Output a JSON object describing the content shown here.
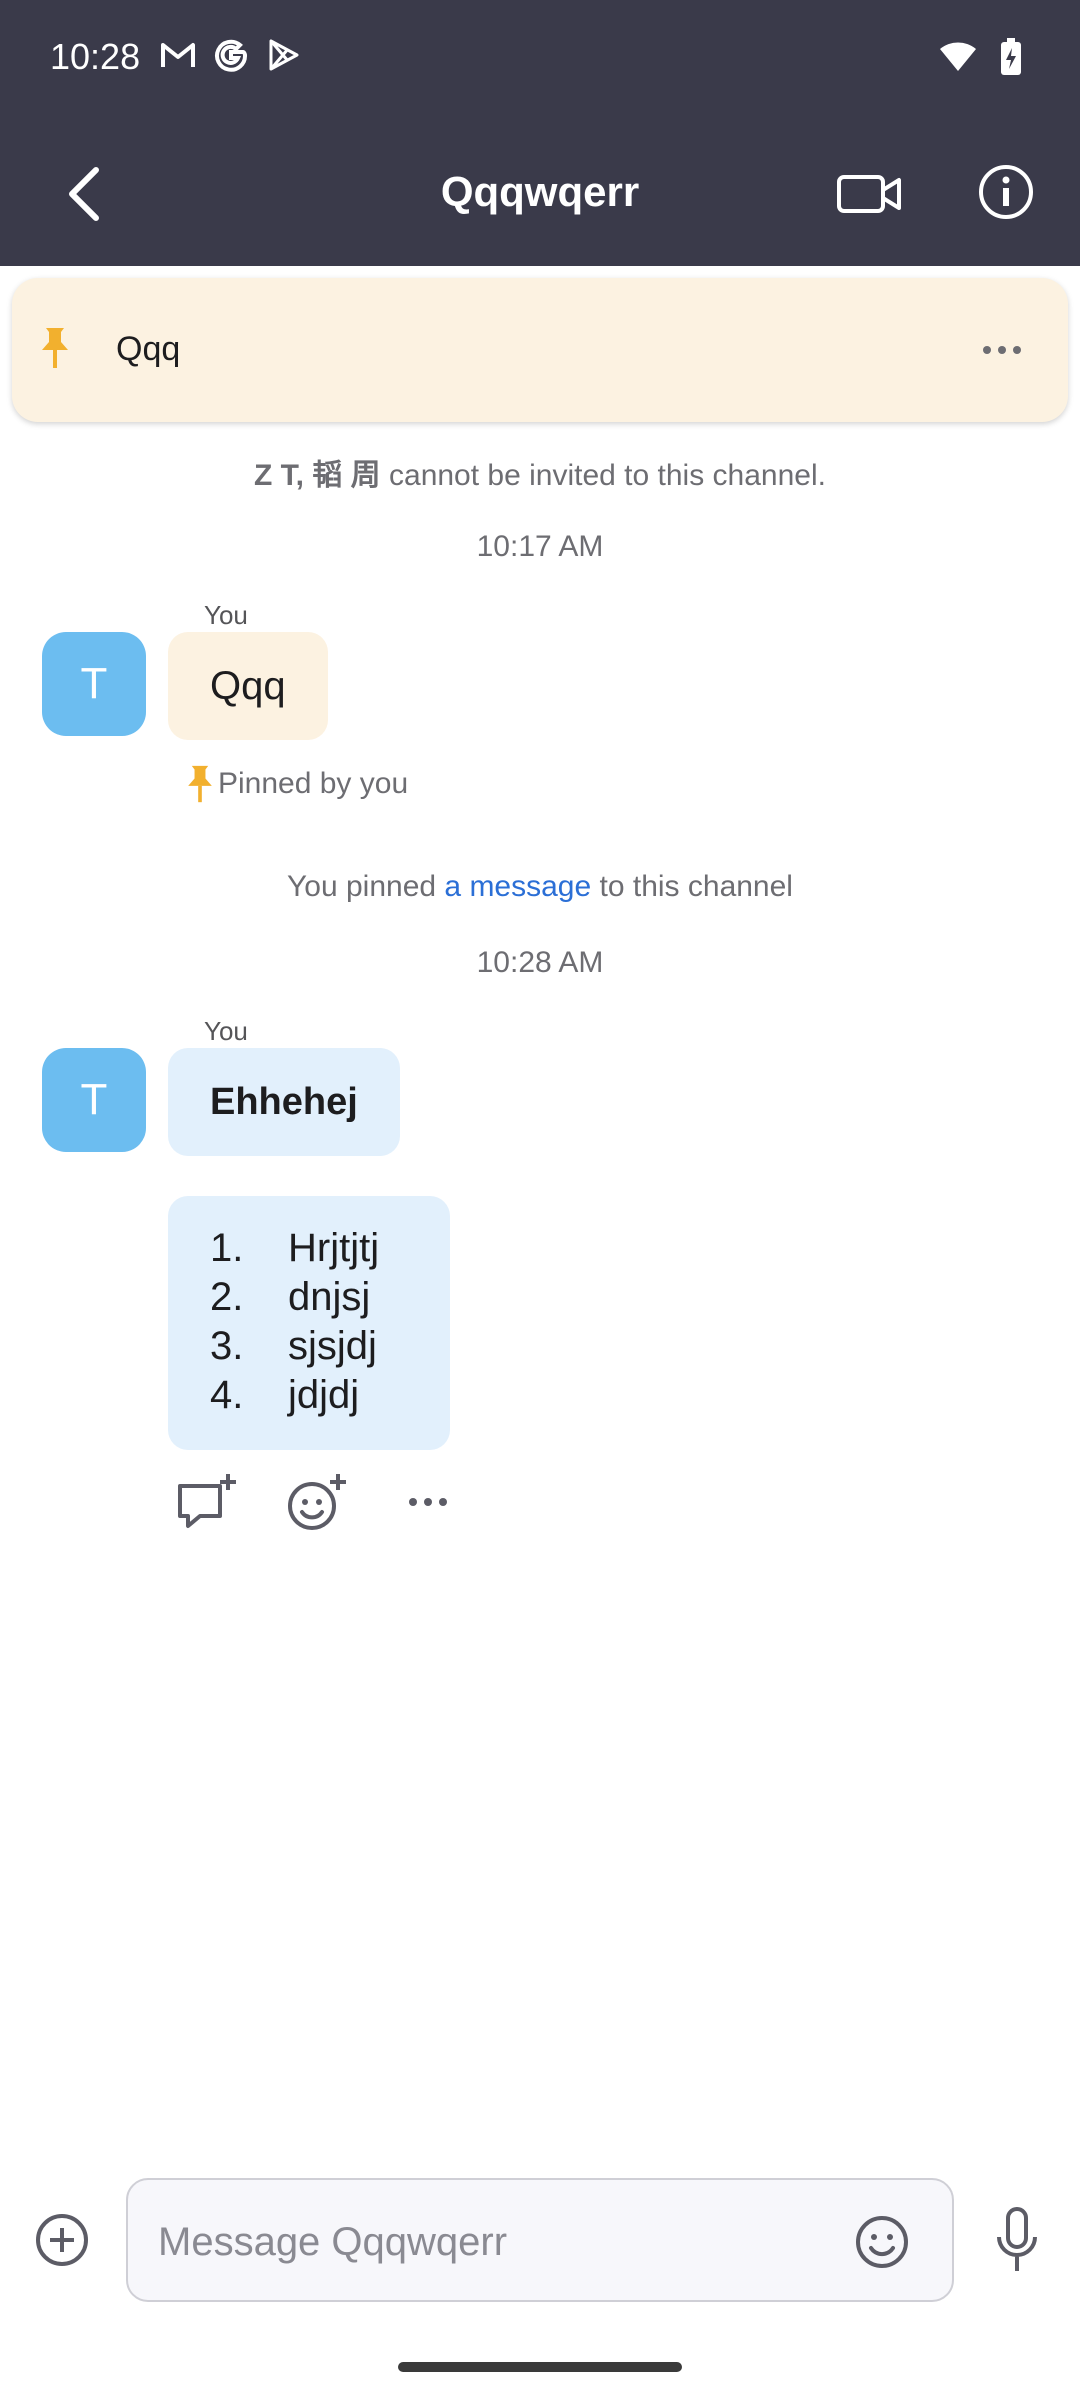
{
  "status_bar": {
    "time": "10:28",
    "left_icons": [
      "gmail-icon",
      "google-icon",
      "play-store-icon"
    ],
    "right_icons": [
      "wifi-icon",
      "battery-charging-icon"
    ]
  },
  "header": {
    "title": "Qqqwqerr",
    "back_icon": "chevron-left-icon",
    "video_icon": "video-camera-icon",
    "info_icon": "info-icon"
  },
  "pinned_banner": {
    "text": "Qqq",
    "pin_icon": "pin-icon",
    "more_icon": "more-horizontal-icon"
  },
  "messages": {
    "invite_notice_names": "Z T, 韬 周",
    "invite_notice_text": " cannot be invited to this channel.",
    "time_1": "10:17 AM",
    "msg1_sender": "You",
    "msg1_avatar": "T",
    "msg1_text": "Qqq",
    "pinned_by": "Pinned by you",
    "pin_notice_prefix": "You pinned ",
    "pin_notice_link": "a message",
    "pin_notice_suffix": " to this channel",
    "time_2": "10:28 AM",
    "msg2_sender": "You",
    "msg2_avatar": "T",
    "msg2_text": "Ehhehej",
    "list_items": [
      {
        "num": "1.",
        "text": "Hrjtjtj"
      },
      {
        "num": "2.",
        "text": "dnjsj"
      },
      {
        "num": "3.",
        "text": "sjsjdj"
      },
      {
        "num": "4.",
        "text": "jdjdj"
      }
    ]
  },
  "composer": {
    "placeholder": "Message Qqqwqerr"
  },
  "colors": {
    "header_bg": "#3a3a4a",
    "pinned_bg": "#fcf2e1",
    "bubble_blue": "#e2f0fc",
    "avatar": "#6cbdf0",
    "link": "#2b6fd6",
    "pin_yellow": "#f2b02e"
  }
}
